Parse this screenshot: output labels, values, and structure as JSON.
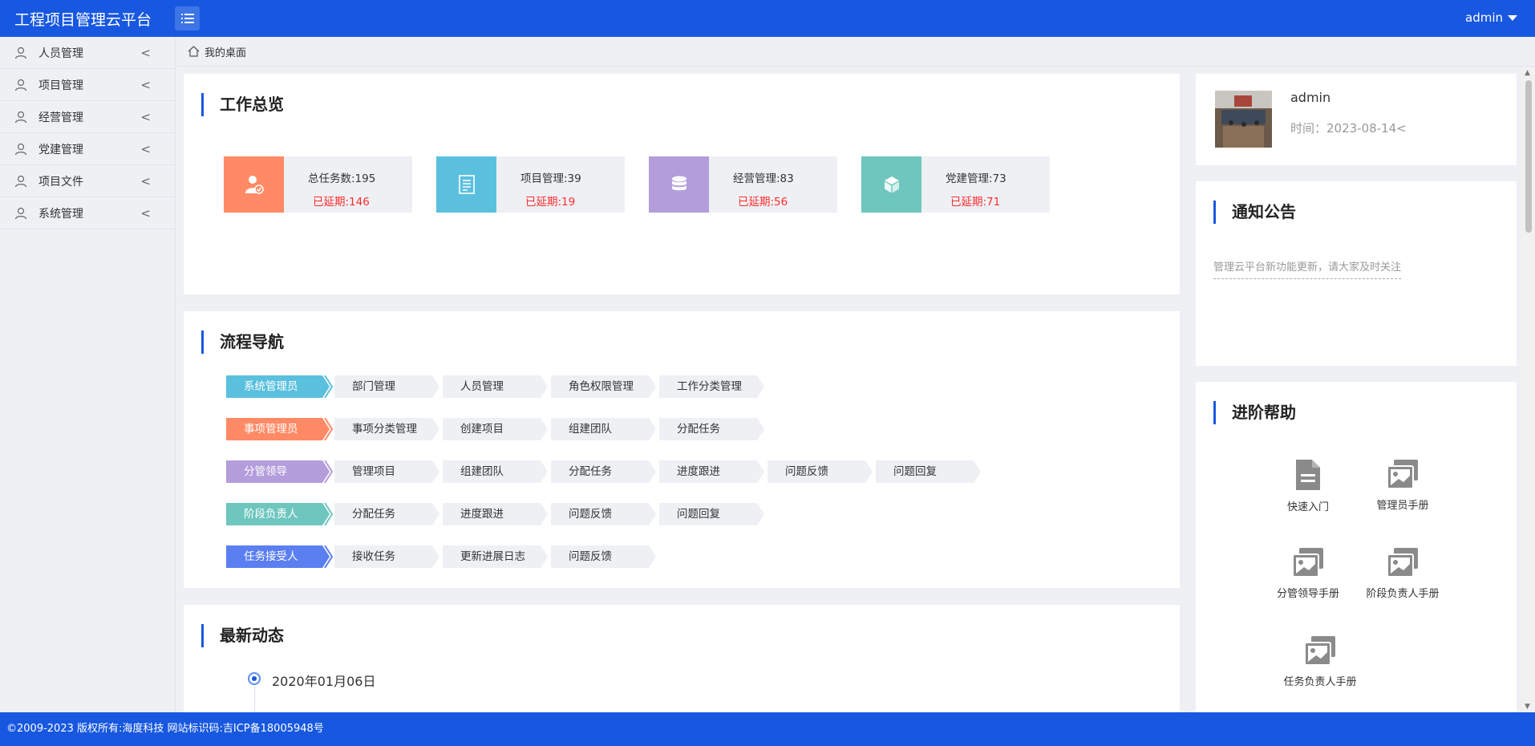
{
  "header": {
    "app_title": "工程项目管理云平台",
    "user": "admin"
  },
  "sidebar": {
    "items": [
      {
        "label": "人员管理"
      },
      {
        "label": "项目管理"
      },
      {
        "label": "经营管理"
      },
      {
        "label": "党建管理"
      },
      {
        "label": "项目文件"
      },
      {
        "label": "系统管理"
      }
    ]
  },
  "breadcrumb": {
    "label": "我的桌面"
  },
  "overview": {
    "title": "工作总览",
    "stats": [
      {
        "label": "总任务数:195",
        "overdue": "已延期:146",
        "color": "#ff8a65",
        "icon": "user-check-icon"
      },
      {
        "label": "项目管理:39",
        "overdue": "已延期:19",
        "color": "#5bc0de",
        "icon": "document-icon"
      },
      {
        "label": "经营管理:83",
        "overdue": "已延期:56",
        "color": "#b39ddb",
        "icon": "database-icon"
      },
      {
        "label": "党建管理:73",
        "overdue": "已延期:71",
        "color": "#6ec6be",
        "icon": "cube-icon"
      }
    ]
  },
  "flow": {
    "title": "流程导航",
    "rows": [
      {
        "role": "系统管理员",
        "color": "#5bc0de",
        "steps": [
          "部门管理",
          "人员管理",
          "角色权限管理",
          "工作分类管理"
        ]
      },
      {
        "role": "事项管理员",
        "color": "#ff8a65",
        "steps": [
          "事项分类管理",
          "创建项目",
          "组建团队",
          "分配任务"
        ]
      },
      {
        "role": "分管领导",
        "color": "#b39ddb",
        "steps": [
          "管理项目",
          "组建团队",
          "分配任务",
          "进度跟进",
          "问题反馈",
          "问题回复"
        ]
      },
      {
        "role": "阶段负责人",
        "color": "#6ec6be",
        "steps": [
          "分配任务",
          "进度跟进",
          "问题反馈",
          "问题回复"
        ]
      },
      {
        "role": "任务接受人",
        "color": "#5b7ff0",
        "steps": [
          "接收任务",
          "更新进展日志",
          "问题反馈"
        ]
      }
    ]
  },
  "news": {
    "title": "最新动态",
    "date": "2020年01月06日"
  },
  "profile": {
    "name": "admin",
    "time": "时间：2023-08-14<"
  },
  "notice": {
    "title": "通知公告",
    "item": "管理云平台新功能更新，请大家及时关注"
  },
  "help": {
    "title": "进阶帮助",
    "items": [
      {
        "label": "快速入门",
        "icon": "file-icon"
      },
      {
        "label": "管理员手册",
        "icon": "image-icon"
      },
      {
        "label": "分管领导手册",
        "icon": "image-icon"
      },
      {
        "label": "阶段负责人手册",
        "icon": "image-icon"
      },
      {
        "label": "任务负责人手册",
        "icon": "image-icon"
      }
    ]
  },
  "footer": {
    "text": "©2009-2023 版权所有:海度科技 网站标识码:吉ICP备18005948号"
  }
}
